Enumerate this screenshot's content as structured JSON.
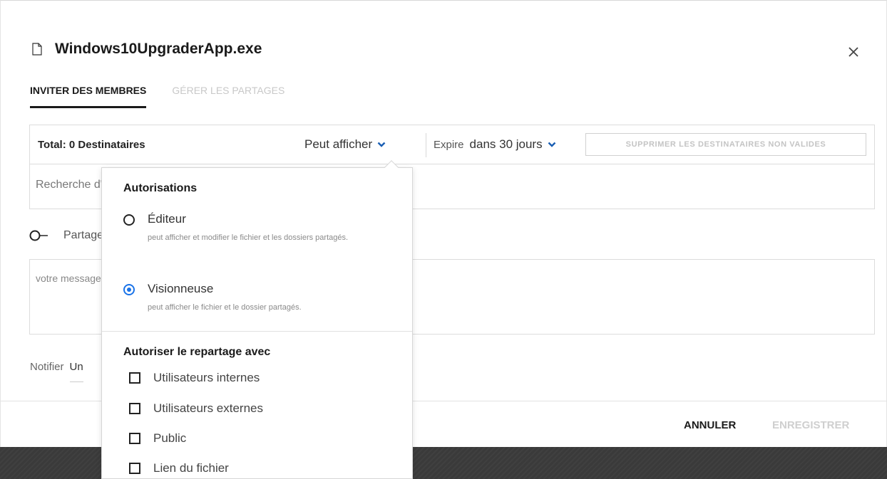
{
  "dialog": {
    "file_name": "Windows10UpgraderApp.exe",
    "close_icon": "close-icon"
  },
  "tabs": [
    {
      "label": "INVITER DES MEMBRES",
      "active": true
    },
    {
      "label": "GÉRER LES PARTAGES",
      "active": false
    }
  ],
  "recipients": {
    "total": "Total: 0 Destinataires",
    "permission": "Peut afficher",
    "expire_label": "Expire",
    "expire_value": "dans 30 jours",
    "remove_invalid": "SUPPRIMER LES DESTINATAIRES NON VALIDES"
  },
  "search": {
    "placeholder": "Recherche d'adresses électroniques séparées par une \",\""
  },
  "share": {
    "label": "Partager"
  },
  "message": {
    "placeholder": "votre message"
  },
  "notify": {
    "label": "Notifier",
    "value": "Un"
  },
  "footer": {
    "cancel": "ANNULER",
    "save": "ENREGISTRER"
  },
  "permissions_menu": {
    "heading": "Autorisations",
    "options": [
      {
        "title": "Éditeur",
        "desc": "peut afficher et modifier le fichier et les dossiers partagés.",
        "selected": false
      },
      {
        "title": "Visionneuse",
        "desc": "peut afficher le fichier et le dossier partagés.",
        "selected": true
      }
    ],
    "reshare_heading": "Autoriser le repartage avec",
    "reshare": [
      {
        "label": "Utilisateurs internes",
        "checked": false
      },
      {
        "label": "Utilisateurs externes",
        "checked": false
      },
      {
        "label": "Public",
        "checked": false
      },
      {
        "label": "Lien du fichier",
        "checked": false
      }
    ]
  },
  "colors": {
    "accent": "#1a73e8",
    "backdrop": "#3a3a3a",
    "disabled": "#c8c8c8"
  }
}
